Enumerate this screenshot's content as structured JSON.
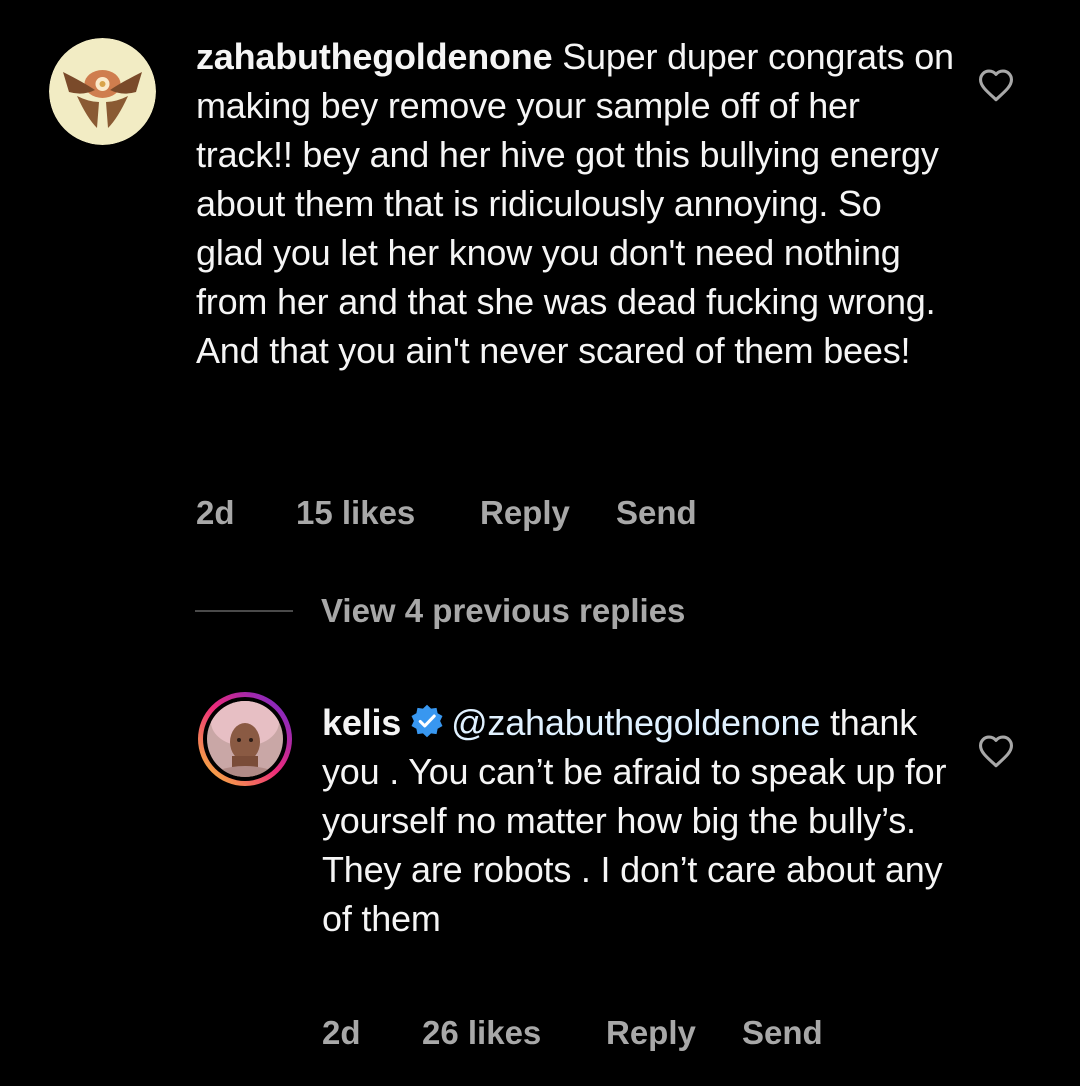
{
  "colors": {
    "background": "#000000",
    "text": "#f5f5f5",
    "secondary_text": "#a8a8a8",
    "verified_blue": "#3897f0",
    "story_ring_gradient": [
      "#f9ce34",
      "#ee2a7b",
      "#6228d7"
    ]
  },
  "comments": [
    {
      "username": "zahabuthegoldenone",
      "text": "Super duper congrats on making bey remove your sample off of her track!! bey and her hive got this bullying energy about them that is ridiculously annoying. So glad you let her know you don't need nothing from her and that she was dead fucking wrong. And that you ain't never scared of them bees!",
      "time": "2d",
      "likes": "15 likes",
      "reply_label": "Reply",
      "send_label": "Send",
      "avatar_icon": "avatar-image",
      "like_icon": "heart-outline-icon"
    }
  ],
  "view_replies_label": "View 4 previous replies",
  "reply": {
    "username": "kelis",
    "verified": true,
    "verified_icon": "verified-badge-icon",
    "mention": "@zahabuthegoldenone",
    "text": "thank you . You can’t be afraid to speak up for yourself no matter how big the bully’s. They are robots . I don’t care about any of them",
    "time": "2d",
    "likes": "26 likes",
    "reply_label": "Reply",
    "send_label": "Send",
    "has_story_ring": true,
    "like_icon": "heart-outline-icon"
  }
}
